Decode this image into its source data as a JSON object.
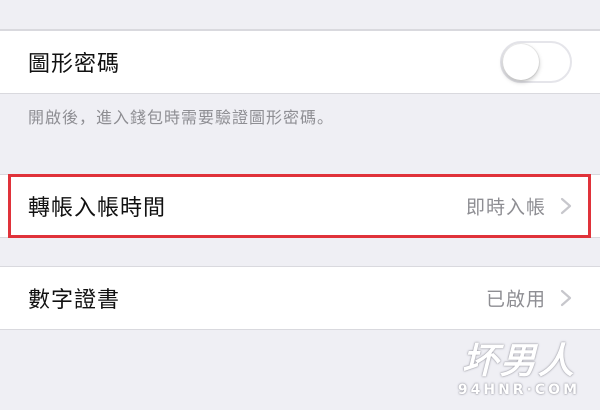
{
  "settings": {
    "pattern_password": {
      "label": "圖形密碼",
      "enabled": false,
      "footnote": "開啟後，進入錢包時需要驗證圖形密碼。"
    },
    "transfer_time": {
      "label": "轉帳入帳時間",
      "value": "即時入帳"
    },
    "digital_certificate": {
      "label": "數字證書",
      "value": "已啟用"
    }
  },
  "annotation": {
    "color": "#e0323a"
  },
  "watermark": {
    "main": "坏男人",
    "sub": "94HNR·COM"
  },
  "colors": {
    "background": "#efeff4",
    "cell": "#ffffff",
    "secondary_text": "#8e8e93"
  }
}
